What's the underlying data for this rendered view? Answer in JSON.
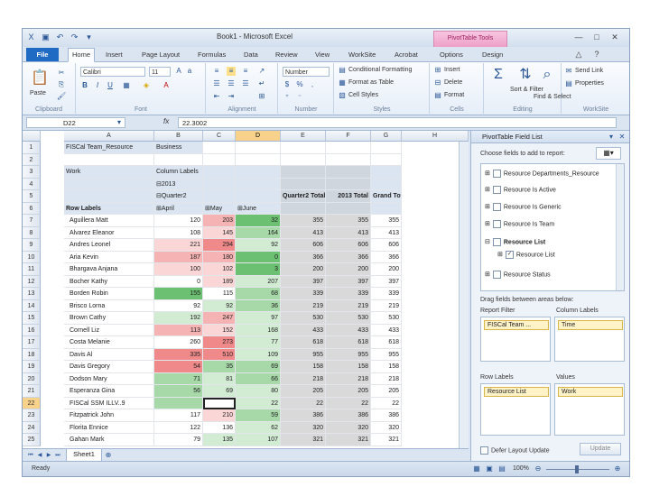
{
  "app": {
    "title": "Book1 - Microsoft Excel",
    "context_tab": "PivotTable Tools",
    "window_controls": [
      "minimize-icon",
      "maximize-icon",
      "close-icon"
    ]
  },
  "ribbon": {
    "tabs": [
      "File",
      "Home",
      "Insert",
      "Page Layout",
      "Formulas",
      "Data",
      "Review",
      "View",
      "WorkSite",
      "Acrobat",
      "Options",
      "Design"
    ],
    "active_tab": "Home",
    "groups": {
      "clipboard": {
        "label": "Clipboard",
        "paste": "Paste"
      },
      "font": {
        "label": "Font",
        "font_name": "Calibri",
        "font_size": "11"
      },
      "alignment": {
        "label": "Alignment"
      },
      "number": {
        "label": "Number",
        "format": "Number"
      },
      "styles": {
        "label": "Styles",
        "conditional": "Conditional Formatting",
        "format_table": "Format as Table",
        "cell_styles": "Cell Styles"
      },
      "cells": {
        "label": "Cells",
        "insert": "Insert",
        "delete": "Delete",
        "format": "Format"
      },
      "editing": {
        "label": "Editing",
        "sort": "Sort & Filter",
        "find": "Find & Select"
      },
      "worksite": {
        "label": "WorkSite",
        "send_link": "Send Link",
        "properties": "Properties"
      }
    }
  },
  "formula_bar": {
    "name_box": "D22",
    "fx": "fx",
    "formula": "22.3002"
  },
  "grid": {
    "columns": [
      "A",
      "B",
      "C",
      "D",
      "E",
      "F",
      "G",
      "H"
    ],
    "selected_column": "D",
    "selected_row": "22",
    "row_numbers": [
      "1",
      "2",
      "3",
      "4",
      "5",
      "6",
      "7",
      "8",
      "9",
      "10",
      "11",
      "12",
      "13",
      "14",
      "15",
      "16",
      "17",
      "18",
      "19",
      "20",
      "21",
      "22",
      "23",
      "24",
      "25"
    ],
    "rows": [
      [
        "FISCal Team_Resource",
        "Business",
        "",
        "",
        "",
        "",
        ""
      ],
      [
        "",
        "",
        "",
        "",
        "",
        "",
        ""
      ],
      [
        "Work",
        "Column Labels",
        "",
        "",
        "",
        "",
        ""
      ],
      [
        "",
        "⊟2013",
        "",
        "",
        "",
        "",
        ""
      ],
      [
        "",
        "⊟Quarter2",
        "",
        "",
        "Quarter2 Total",
        "2013 Total",
        "Grand Total"
      ],
      [
        "Row Labels",
        "⊞April",
        "⊞May",
        "⊞June",
        "",
        "",
        ""
      ],
      [
        "Aguillera Matt",
        "120",
        "203",
        "32",
        "355",
        "355",
        "355"
      ],
      [
        "Alvarez Eleanor",
        "108",
        "145",
        "164",
        "413",
        "413",
        "413"
      ],
      [
        "Andres Leonel",
        "221",
        "294",
        "92",
        "606",
        "606",
        "606"
      ],
      [
        "Aria Kevin",
        "187",
        "180",
        "0",
        "366",
        "366",
        "366"
      ],
      [
        "Bhargava Anjana",
        "100",
        "102",
        "3",
        "200",
        "200",
        "200"
      ],
      [
        "Bocher Kathy",
        "0",
        "189",
        "207",
        "397",
        "397",
        "397"
      ],
      [
        "Borden Robin",
        "155",
        "115",
        "68",
        "339",
        "339",
        "339"
      ],
      [
        "Brisco Lorna",
        "92",
        "92",
        "36",
        "219",
        "219",
        "219"
      ],
      [
        "Brown Cathy",
        "192",
        "247",
        "97",
        "530",
        "530",
        "530"
      ],
      [
        "Cornell Liz",
        "113",
        "152",
        "168",
        "433",
        "433",
        "433"
      ],
      [
        "Costa Melanie",
        "260",
        "273",
        "77",
        "618",
        "618",
        "618"
      ],
      [
        "Davis Al",
        "335",
        "510",
        "109",
        "955",
        "955",
        "955"
      ],
      [
        "Davis Gregory",
        "54",
        "35",
        "69",
        "158",
        "158",
        "158"
      ],
      [
        "Dodson Mary",
        "71",
        "81",
        "66",
        "218",
        "218",
        "218"
      ],
      [
        "Esperanza Gina",
        "56",
        "69",
        "80",
        "205",
        "205",
        "205"
      ],
      [
        "FISCal SSM ILLV..9",
        "",
        "",
        "22",
        "22",
        "22",
        "22"
      ],
      [
        "Fitzpatrick John",
        "117",
        "210",
        "59",
        "386",
        "386",
        "386"
      ],
      [
        "Florita Ennice",
        "122",
        "136",
        "62",
        "320",
        "320",
        "320"
      ],
      [
        "Gahan Mark",
        "79",
        "135",
        "107",
        "321",
        "321",
        "321"
      ]
    ],
    "heat": {
      "colors": {
        "r3": "#f08a8a",
        "r2": "#f6b3b3",
        "r1": "#fbd6d6",
        "w": "#ffffff",
        "g1": "#d2ebd3",
        "g2": "#a6d8a8",
        "g3": "#6cc072"
      },
      "B": [
        "w",
        "w",
        "r1",
        "r2",
        "r1",
        "w",
        "g3",
        "w",
        "g1",
        "r2",
        "w",
        "r3",
        "r3",
        "g2",
        "g2",
        "g2",
        "w",
        "w",
        "w"
      ],
      "C": [
        "r2",
        "r1",
        "r3",
        "r2",
        "r1",
        "r1",
        "w",
        "g1",
        "r2",
        "r1",
        "r3",
        "r3",
        "g2",
        "g1",
        "g1",
        "w",
        "r1",
        "w",
        "g1"
      ],
      "D": [
        "g3",
        "g2",
        "g1",
        "g3",
        "g3",
        "g1",
        "g2",
        "g2",
        "g1",
        "g1",
        "g1",
        "g1",
        "g2",
        "g2",
        "g1",
        "g1",
        "g2",
        "g1",
        "g1"
      ]
    }
  },
  "sheet_tabs": {
    "active": "Sheet1"
  },
  "status": {
    "ready": "Ready",
    "zoom": "100%"
  },
  "pivot_panel": {
    "title": "PivotTable Field List",
    "choose_label": "Choose fields to add to report:",
    "fields": [
      {
        "label": "Resource Departments_Resource",
        "checked": false,
        "expand": "⊞"
      },
      {
        "label": "Resource Is Active",
        "checked": false,
        "expand": "⊞"
      },
      {
        "label": "Resource Is Generic",
        "checked": false,
        "expand": "⊞"
      },
      {
        "label": "Resource Is Team",
        "checked": false,
        "expand": "⊞"
      },
      {
        "label": "Resource List",
        "checked": false,
        "expand": "⊟"
      },
      {
        "label": "Resource List",
        "checked": true,
        "expand": "⊞"
      },
      {
        "label": "Resource Status",
        "checked": false,
        "expand": "⊞"
      }
    ],
    "drag_label": "Drag fields between areas below:",
    "areas": {
      "report_filter": {
        "label": "Report Filter",
        "chip": "FISCal Team ..."
      },
      "column_labels": {
        "label": "Column Labels",
        "chip": "Time"
      },
      "row_labels": {
        "label": "Row Labels",
        "chip": "Resource List"
      },
      "values": {
        "label": "Values",
        "chip": "Work"
      }
    },
    "defer_label": "Defer Layout Update",
    "update_button": "Update"
  }
}
